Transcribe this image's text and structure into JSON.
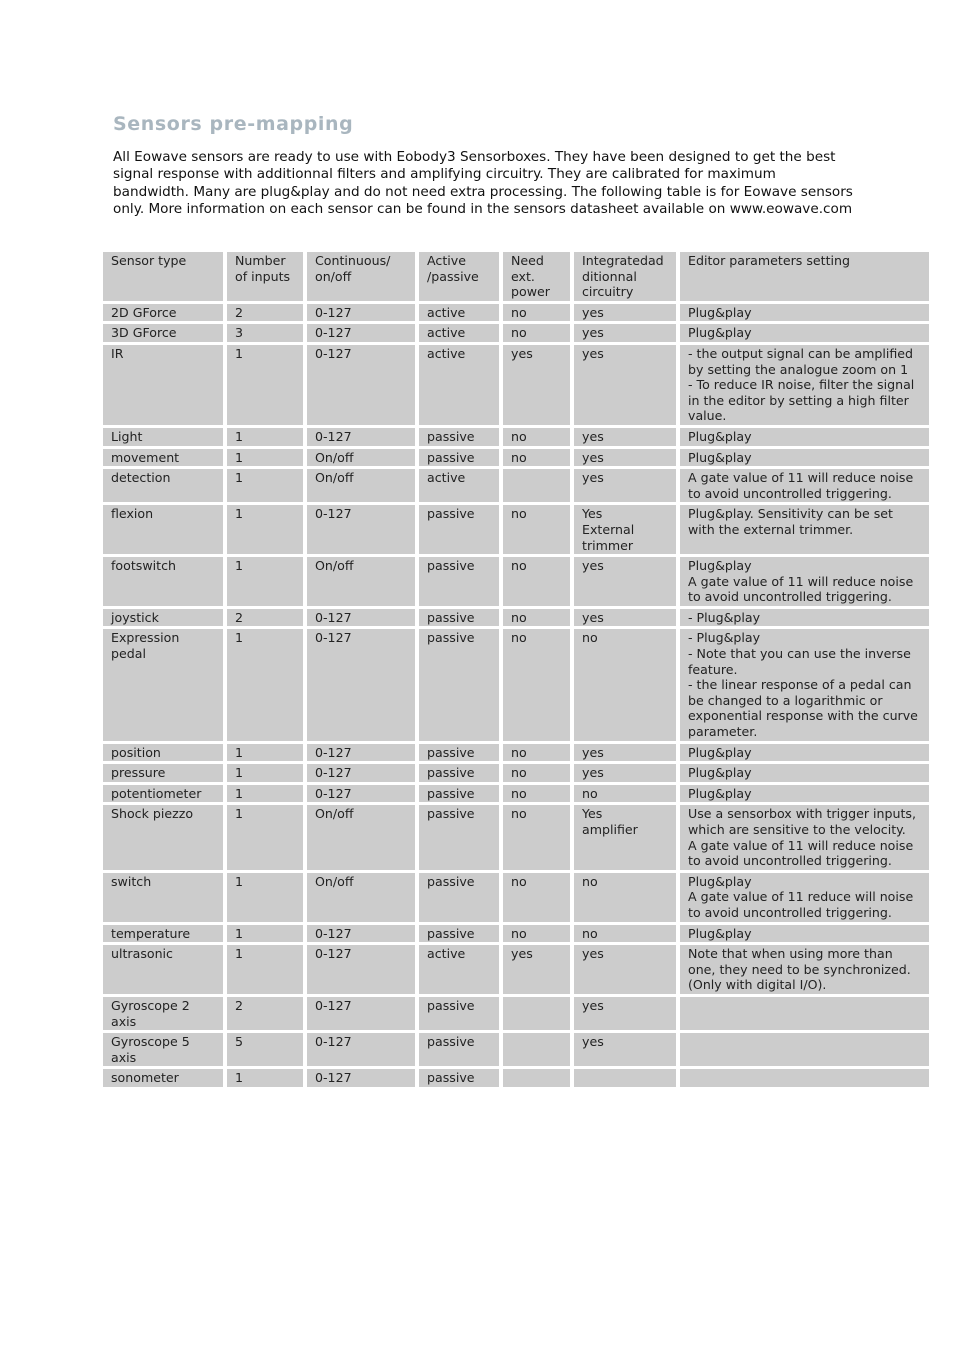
{
  "title": "Sensors pre-mapping",
  "intro": "All Eowave sensors are ready to use with Eobody3 Sensorboxes. They have been designed to get the best signal response with additionnal filters and amplifying circuitry. They are calibrated for maximum bandwidth. Many are plug&play and do not need extra processing. The following table is for Eowave sensors only. More information on each sensor can be found in the sensors datasheet available on www.eowave.com",
  "table": {
    "headers": [
      "Sensor type",
      "Number of inputs",
      "Continuous/ on/off",
      "Active /passive",
      "Need ext. power",
      "Integratedad ditionnal circuitry",
      "Editor parameters setting"
    ],
    "rows": [
      [
        "2D GForce",
        "2",
        "0-127",
        "active",
        "no",
        "yes",
        "Plug&play"
      ],
      [
        "3D GForce",
        "3",
        "0-127",
        "active",
        "no",
        "yes",
        "Plug&play"
      ],
      [
        "IR",
        "1",
        "0-127",
        "active",
        "yes",
        "yes",
        "- the output signal can be amplified by setting the analogue zoom on 1\n- To reduce IR noise, filter the signal in the editor by setting a high filter value."
      ],
      [
        "Light",
        "1",
        "0-127",
        "passive",
        "no",
        "yes",
        "Plug&play"
      ],
      [
        "movement",
        "1",
        "On/off",
        "passive",
        "no",
        "yes",
        "Plug&play"
      ],
      [
        "detection",
        "1",
        "On/off",
        "active",
        "",
        "yes",
        "A gate value of 11 will reduce noise to avoid uncontrolled triggering."
      ],
      [
        "flexion",
        "1",
        "0-127",
        "passive",
        "no",
        "Yes\nExternal trimmer",
        "Plug&play. Sensitivity can be set with the external trimmer."
      ],
      [
        "footswitch",
        "1",
        "On/off",
        "passive",
        "no",
        "yes",
        "Plug&play\nA gate value of 11 will reduce noise to avoid uncontrolled triggering."
      ],
      [
        "joystick",
        "2",
        "0-127",
        "passive",
        "no",
        "yes",
        "- Plug&play"
      ],
      [
        "Expression pedal",
        "1",
        "0-127",
        "passive",
        "no",
        "no",
        "- Plug&play\n- Note that you can use the inverse feature.\n- the linear response of a pedal can be changed to a logarithmic or exponential response with the curve parameter."
      ],
      [
        "position",
        "1",
        "0-127",
        "passive",
        "no",
        "yes",
        "Plug&play"
      ],
      [
        "pressure",
        "1",
        "0-127",
        "passive",
        "no",
        "yes",
        "Plug&play"
      ],
      [
        "potentiometer",
        "1",
        "0-127",
        "passive",
        "no",
        "no",
        "Plug&play"
      ],
      [
        "Shock piezzo",
        "1",
        "On/off",
        "passive",
        "no",
        "Yes\namplifier",
        "Use a sensorbox with trigger inputs, which are sensitive to the velocity.\nA gate value of 11 will reduce noise to avoid uncontrolled triggering."
      ],
      [
        "switch",
        "1",
        "On/off",
        "passive",
        "no",
        "no",
        "Plug&play\nA gate value of 11 reduce will noise to avoid uncontrolled triggering."
      ],
      [
        "temperature",
        "1",
        "0-127",
        "passive",
        "no",
        "no",
        "Plug&play"
      ],
      [
        "ultrasonic",
        "1",
        "0-127",
        "active",
        "yes",
        "yes",
        "Note that when using more than one, they need to be synchronized. (Only with digital I/O)."
      ],
      [
        "Gyroscope 2 axis",
        "2",
        "0-127",
        "passive",
        "",
        "yes",
        ""
      ],
      [
        "Gyroscope 5 axis",
        "5",
        "0-127",
        "passive",
        "",
        "yes",
        ""
      ],
      [
        "sonometer",
        "1",
        "0-127",
        "passive",
        "",
        "",
        ""
      ]
    ]
  },
  "colors": {
    "title": "#a9b6bf",
    "cell_bg": "#cccccc"
  }
}
